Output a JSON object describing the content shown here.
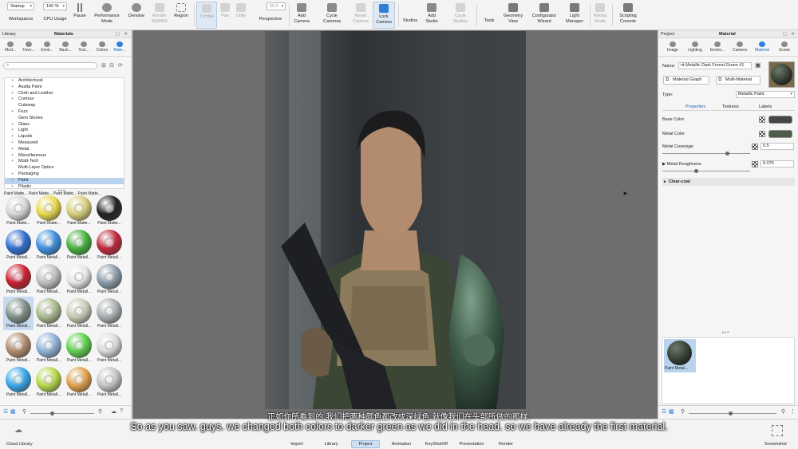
{
  "toolbar": {
    "startup": "Startup",
    "zoom": "100 %",
    "zoom_value": "50.0",
    "buttons": {
      "workspaces": "Workspaces",
      "cpu_usage": "CPU Usage",
      "pause": "Pause",
      "performance_mode": "Performance\nMode",
      "denoise": "Denoise",
      "render_nurbs": "Render\nNURBS",
      "region": "Region",
      "tumble": "Tumble",
      "pan": "Pan",
      "dolly": "Dolly",
      "perspective": "Perspective",
      "add_camera": "Add\nCamera",
      "cycle_cameras": "Cycle\nCameras",
      "reset_camera": "Reset\nCamera",
      "lock_camera": "Lock\nCamera",
      "studios": "Studios",
      "add_studio": "Add\nStudio",
      "cycle_studios": "Cycle\nStudios",
      "tools": "Tools",
      "geometry_view": "Geometry\nView",
      "configurator_wizard": "Configurator\nWizard",
      "light_manager": "Light\nManager",
      "retina_mode": "Retina\nMode",
      "scripting_console": "Scripting\nConsole"
    }
  },
  "library": {
    "header_left": "Library",
    "header_title": "Materials",
    "tabs": [
      "Mod...",
      "Favo...",
      "Envir...",
      "Back...",
      "Text...",
      "Colors",
      "Mate..."
    ],
    "tree": [
      "Architectural",
      "Axalta Paint",
      "Cloth and Leather",
      "Contour",
      "Cutaway",
      "Fuzz",
      "Gem Stones",
      "Glass",
      "Light",
      "Liquids",
      "Measured",
      "Metal",
      "Miscellaneous",
      "Mold-Tech",
      "Multi-Layer Optics",
      "Packaging",
      "Paint",
      "Plastic"
    ],
    "row0_caption": "Paint Matte... Paint Matte... Paint Matte... Paint Matte...",
    "thumbs": [
      {
        "caption": "Paint Matte...",
        "color": "#d8d8d8"
      },
      {
        "caption": "Paint Matte...",
        "color": "#e8d84a"
      },
      {
        "caption": "Paint Matte...",
        "color": "#d7cf7a"
      },
      {
        "caption": "Paint Matte...",
        "color": "#222222"
      },
      {
        "caption": "Paint Metall...",
        "color": "#2f6fd0"
      },
      {
        "caption": "Paint Metall...",
        "color": "#3d8fe0"
      },
      {
        "caption": "Paint Metall...",
        "color": "#44b23b"
      },
      {
        "caption": "Paint Metall...",
        "color": "#c0283a"
      },
      {
        "caption": "Paint Metall...",
        "color": "#c8202e"
      },
      {
        "caption": "Paint Metall...",
        "color": "#bfbfbf"
      },
      {
        "caption": "Paint Metall...",
        "color": "#e6e6e6"
      },
      {
        "caption": "Paint Metall...",
        "color": "#8a9aa8"
      },
      {
        "caption": "Paint Metall...",
        "color": "#7f8f86"
      },
      {
        "caption": "Paint Metall...",
        "color": "#a7b98e"
      },
      {
        "caption": "Paint Metall...",
        "color": "#c9c9b4"
      },
      {
        "caption": "Paint Metall...",
        "color": "#a8adb0"
      },
      {
        "caption": "Paint Metall...",
        "color": "#b08a6c"
      },
      {
        "caption": "Paint Metall...",
        "color": "#8fb0d8"
      },
      {
        "caption": "Paint Metall...",
        "color": "#5ccf4a"
      },
      {
        "caption": "Paint Metall...",
        "color": "#d9d9d9"
      },
      {
        "caption": "Paint Metall...",
        "color": "#35a6e8"
      },
      {
        "caption": "Paint Metall...",
        "color": "#b5d84a"
      },
      {
        "caption": "Paint Metall...",
        "color": "#e0a04a"
      },
      {
        "caption": "Paint Metall...",
        "color": "#c4c4c4"
      }
    ],
    "cloud_library": "Cloud Library"
  },
  "project": {
    "header_left": "Project",
    "header_title": "Material",
    "tabs": [
      "Image",
      "Lighting",
      "Enviro...",
      "Camera",
      "Material",
      "Scene"
    ],
    "name_label": "Name:",
    "name_value": "nt Metallic Dark Forest Green #1",
    "material_graph": "Material Graph",
    "multi_material": "Multi-Material",
    "type_label": "Type:",
    "type_value": "Metallic Paint",
    "subtabs": [
      "Properties",
      "Textures",
      "Labels"
    ],
    "base_color_label": "Base Color",
    "base_color": "#434743",
    "metal_color_label": "Metal Color",
    "metal_color": "#4e5d49",
    "metal_coverage_label": "Metal Coverage",
    "metal_coverage": "0.5",
    "metal_roughness_label": "Metal Roughness",
    "metal_roughness": "0.075",
    "clear_coat": "Clear-coat",
    "preview_caption": "Paint Metal..."
  },
  "bottom": {
    "tabs": [
      "Import",
      "Library",
      "Project",
      "Animation",
      "KeyShotXR",
      "Presentation",
      "Render"
    ],
    "screenshot": "Screenshot"
  },
  "subtitles": {
    "cn": "正如你所看到的,我们把两种颜色都改成深绿色,就像我们在头部所做的那样,",
    "en": "So as you saw. guys. we changed both colors to darker green as we did in the head. so we have already the first material."
  }
}
